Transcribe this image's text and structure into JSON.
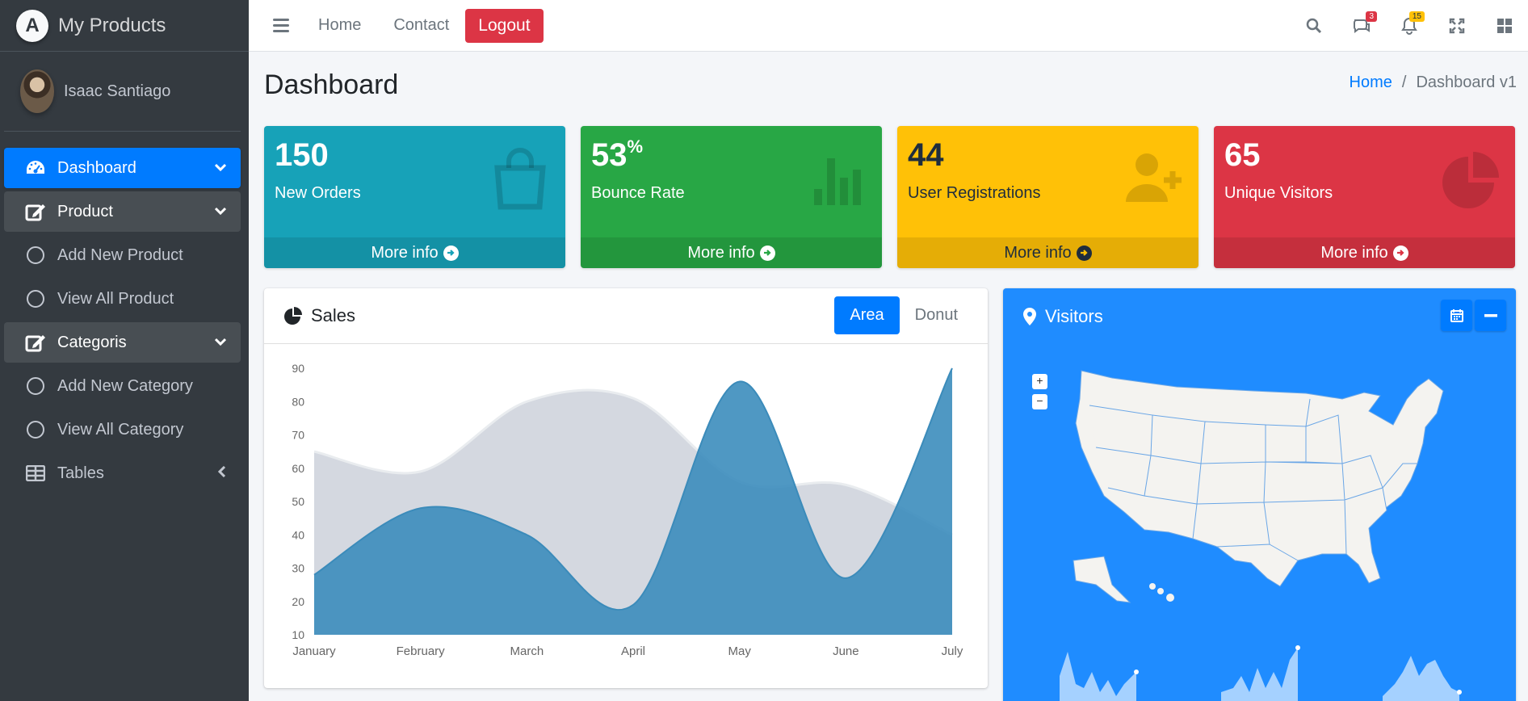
{
  "brand": {
    "title": "My Products",
    "logo_letter": "A"
  },
  "user": {
    "name": "Isaac Santiago"
  },
  "sidebar": {
    "items": [
      {
        "label": "Dashboard"
      },
      {
        "label": "Product"
      },
      {
        "label": "Add New Product"
      },
      {
        "label": "View All Product"
      },
      {
        "label": "Categoris"
      },
      {
        "label": "Add New Category"
      },
      {
        "label": "View All Category"
      },
      {
        "label": "Tables"
      }
    ]
  },
  "topbar": {
    "links": [
      "Home",
      "Contact"
    ],
    "logout": "Logout",
    "messages_badge": "3",
    "notifications_badge": "15"
  },
  "header": {
    "title": "Dashboard",
    "breadcrumb_home": "Home",
    "breadcrumb_sep": "/",
    "breadcrumb_current": "Dashboard v1"
  },
  "boxes": [
    {
      "value": "150",
      "suffix": "",
      "label": "New Orders",
      "footer": "More info",
      "color": "#17a2b8",
      "icon": "shopping-bag-icon"
    },
    {
      "value": "53",
      "suffix": "%",
      "label": "Bounce Rate",
      "footer": "More info",
      "color": "#28a745",
      "icon": "bar-chart-icon"
    },
    {
      "value": "44",
      "suffix": "",
      "label": "User Registrations",
      "footer": "More info",
      "color": "#ffc107",
      "icon": "user-plus-icon"
    },
    {
      "value": "65",
      "suffix": "",
      "label": "Unique Visitors",
      "footer": "More info",
      "color": "#dc3545",
      "icon": "pie-chart-icon"
    }
  ],
  "sales": {
    "title": "Sales",
    "tabs": [
      "Area",
      "Donut"
    ],
    "active_tab": "Area"
  },
  "visitors": {
    "title": "Visitors",
    "zoom_in": "+",
    "zoom_out": "−"
  },
  "chart_data": {
    "type": "area",
    "categories": [
      "January",
      "February",
      "March",
      "April",
      "May",
      "June",
      "July"
    ],
    "y_ticks": [
      90,
      80,
      70,
      60,
      50,
      40,
      30,
      20,
      10
    ],
    "ylim": [
      10,
      90
    ],
    "series": [
      {
        "values": [
          65,
          59,
          80,
          81,
          56,
          55,
          40
        ],
        "color": "#d2d6de"
      },
      {
        "values": [
          28,
          48,
          40,
          19,
          86,
          27,
          90
        ],
        "color": "#3c8dbc"
      }
    ]
  }
}
